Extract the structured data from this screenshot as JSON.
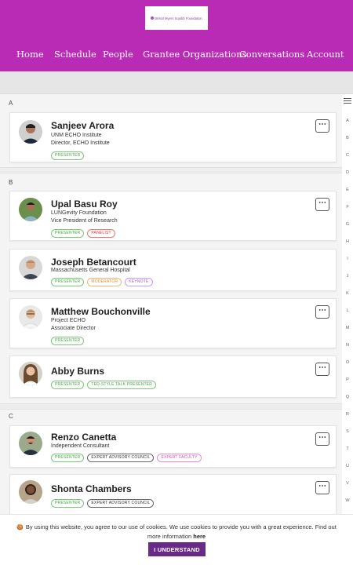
{
  "logo": {
    "text": "Bristol Myers Squibb Foundation"
  },
  "nav": [
    "Home",
    "Schedule",
    "People",
    "Grantee Organizations",
    "Conversations",
    "Account"
  ],
  "sections": [
    {
      "letter": "A",
      "people": [
        {
          "name": "Sanjeev Arora",
          "org": "UNM ECHO Institute",
          "role": "Director, ECHO Institute",
          "tags": [
            {
              "label": "Presenter",
              "style": "green"
            }
          ]
        }
      ]
    },
    {
      "letter": "B",
      "people": [
        {
          "name": "Upal Basu Roy",
          "org": "LUNGevity Foundation",
          "role": "Vice President of Research",
          "tags": [
            {
              "label": "Presenter",
              "style": "green"
            },
            {
              "label": "Panelist",
              "style": "red"
            }
          ]
        },
        {
          "name": "Joseph Betancourt",
          "org": "Massachusetts General Hospital",
          "role": "",
          "tags": [
            {
              "label": "Presenter",
              "style": "green"
            },
            {
              "label": "Moderator",
              "style": "orange"
            },
            {
              "label": "Keynote",
              "style": "purple"
            }
          ]
        },
        {
          "name": "Matthew Bouchonville",
          "org": "Project ECHO",
          "role": "Associate Director",
          "tags": [
            {
              "label": "Presenter",
              "style": "green"
            }
          ]
        },
        {
          "name": "Abby Burns",
          "org": "",
          "role": "",
          "tags": [
            {
              "label": "Presenter",
              "style": "green"
            },
            {
              "label": "Ted-Style Talk Presenter",
              "style": "green"
            }
          ]
        }
      ]
    },
    {
      "letter": "C",
      "people": [
        {
          "name": "Renzo Canetta",
          "org": "Independent Consultant",
          "role": "",
          "tags": [
            {
              "label": "Presenter",
              "style": "green"
            },
            {
              "label": "Expert Advisory Council",
              "style": "dark"
            },
            {
              "label": "Expert Faculty",
              "style": "pink"
            }
          ]
        },
        {
          "name": "Shonta Chambers",
          "org": "",
          "role": "",
          "tags": [
            {
              "label": "Presenter",
              "style": "green"
            },
            {
              "label": "Expert Advisory Council",
              "style": "dark"
            }
          ]
        }
      ]
    }
  ],
  "more_button": "⋯",
  "index_icon": "list-icon",
  "index_letters": [
    "A",
    "B",
    "C",
    "D",
    "E",
    "F",
    "G",
    "H",
    "I",
    "J",
    "K",
    "L",
    "M",
    "N",
    "O",
    "P",
    "Q",
    "R",
    "S",
    "T",
    "U",
    "V",
    "W"
  ],
  "cookie": {
    "text": "By using this website, you agree to our use of cookies. We use cookies to provide you with a great experience. Find out more information",
    "link": "here",
    "button": "I UNDERSTAND"
  },
  "colors": {
    "header": "#b92bb4",
    "button": "#6a2a8a"
  }
}
